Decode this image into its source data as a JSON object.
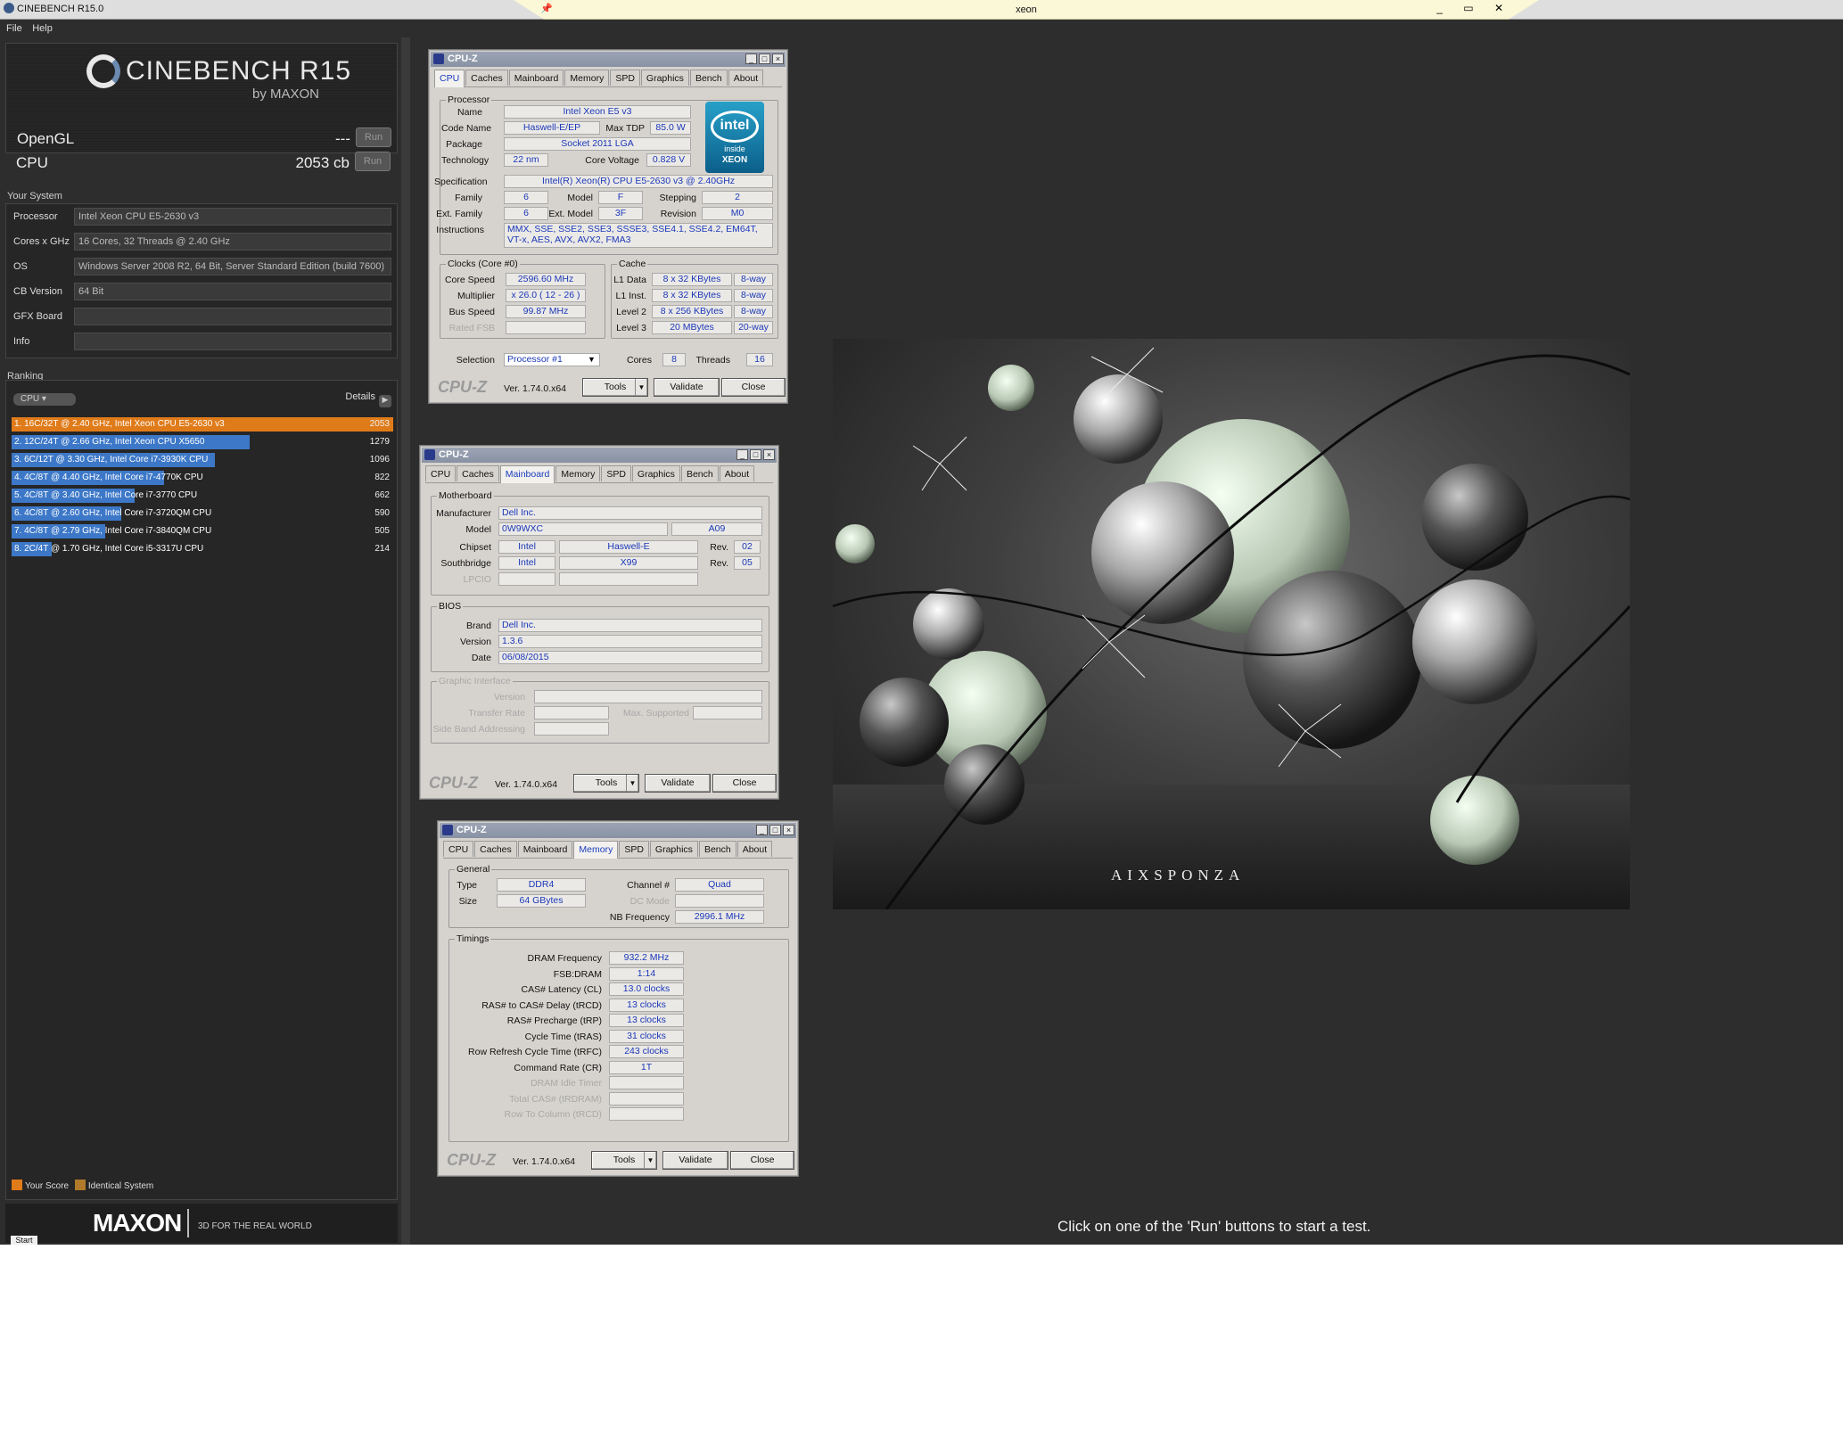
{
  "window": {
    "title": "CINEBENCH R15.0",
    "rdp_title": "xeon",
    "rdp_controls": "_ ▭ ✕"
  },
  "menu": [
    "File",
    "Help"
  ],
  "cinebench": {
    "logo_name": "CINEBENCH R15",
    "logo_by": "by MAXON",
    "opengl": {
      "label": "OpenGL",
      "value": "---",
      "button": "Run"
    },
    "cpu": {
      "label": "CPU",
      "value": "2053 cb",
      "button": "Run"
    },
    "your_system_heading": "Your System",
    "system": [
      {
        "key": "Processor",
        "value": "Intel Xeon CPU E5-2630 v3"
      },
      {
        "key": "Cores x GHz",
        "value": "16 Cores, 32 Threads @ 2.40 GHz"
      },
      {
        "key": "OS",
        "value": "Windows Server 2008 R2, 64 Bit, Server Standard Edition (build 7600)"
      },
      {
        "key": "CB Version",
        "value": "64 Bit"
      },
      {
        "key": "GFX Board",
        "value": ""
      },
      {
        "key": "Info",
        "value": ""
      }
    ],
    "ranking_heading": "Ranking",
    "ranking_filter": "CPU",
    "details_label": "Details",
    "ranking": [
      {
        "text": "1. 16C/32T @ 2.40 GHz, Intel Xeon CPU E5-2630 v3",
        "score": "2053",
        "kind": "your"
      },
      {
        "text": "2. 12C/24T @ 2.66 GHz, Intel Xeon CPU X5650",
        "score": "1279",
        "kind": "ref"
      },
      {
        "text": "3. 6C/12T @ 3.30 GHz,  Intel Core i7-3930K CPU",
        "score": "1096",
        "kind": "ref"
      },
      {
        "text": "4. 4C/8T @ 4.40 GHz, Intel Core i7-4770K CPU",
        "score": "822",
        "kind": "ref"
      },
      {
        "text": "5. 4C/8T @ 3.40 GHz,  Intel Core i7-3770 CPU",
        "score": "662",
        "kind": "ref"
      },
      {
        "text": "6. 4C/8T @ 2.60 GHz, Intel Core i7-3720QM CPU",
        "score": "590",
        "kind": "ref"
      },
      {
        "text": "7. 4C/8T @ 2.79 GHz,  Intel Core i7-3840QM CPU",
        "score": "505",
        "kind": "ref"
      },
      {
        "text": "8. 2C/4T @ 1.70 GHz,  Intel Core i5-3317U CPU",
        "score": "214",
        "kind": "ref"
      }
    ],
    "legend": {
      "your_score": "Your Score",
      "identical": "Identical System"
    },
    "maxon": "MAXON",
    "tagline": "3D FOR THE REAL WORLD",
    "start": "Start",
    "status": "Click on one of the 'Run' buttons to start a test.",
    "render_brand": "AIXSPONZA",
    "colors": {
      "your_score": "#e07b1a",
      "identical": "#b07a2a",
      "reference": "#3d78c8"
    }
  },
  "cpuz_common": {
    "title": "CPU-Z",
    "tabs": [
      "CPU",
      "Caches",
      "Mainboard",
      "Memory",
      "SPD",
      "Graphics",
      "Bench",
      "About"
    ],
    "logo": "CPU-Z",
    "version": "Ver. 1.74.0.x64",
    "tools": "Tools",
    "validate": "Validate",
    "close": "Close"
  },
  "cpuz_cpu": {
    "active_tab": "CPU",
    "processor_group": "Processor",
    "name_label": "Name",
    "name": "Intel Xeon E5 v3",
    "codename_label": "Code Name",
    "codename": "Haswell-E/EP",
    "maxtdp_label": "Max TDP",
    "maxtdp": "85.0 W",
    "package_label": "Package",
    "package": "Socket 2011 LGA",
    "technology_label": "Technology",
    "technology": "22 nm",
    "corevoltage_label": "Core Voltage",
    "corevoltage": "0.828 V",
    "spec_label": "Specification",
    "spec": "Intel(R) Xeon(R) CPU E5-2630 v3 @ 2.40GHz",
    "family_label": "Family",
    "family": "6",
    "model_label": "Model",
    "model": "F",
    "stepping_label": "Stepping",
    "stepping": "2",
    "extfamily_label": "Ext. Family",
    "extfamily": "6",
    "extmodel_label": "Ext. Model",
    "extmodel": "3F",
    "revision_label": "Revision",
    "revision": "M0",
    "instructions_label": "Instructions",
    "instructions": "MMX, SSE, SSE2, SSE3, SSSE3, SSE4.1, SSE4.2, EM64T, VT-x, AES, AVX, AVX2, FMA3",
    "clocks_group": "Clocks (Core #0)",
    "corespeed_label": "Core Speed",
    "corespeed": "2596.60 MHz",
    "multiplier_label": "Multiplier",
    "multiplier": "x 26.0 ( 12 - 26 )",
    "busspeed_label": "Bus Speed",
    "busspeed": "99.87 MHz",
    "ratedfsb_label": "Rated FSB",
    "cache_group": "Cache",
    "l1d_label": "L1 Data",
    "l1d": "8 x 32 KBytes",
    "l1d_way": "8-way",
    "l1i_label": "L1 Inst.",
    "l1i": "8 x 32 KBytes",
    "l1i_way": "8-way",
    "l2_label": "Level 2",
    "l2": "8 x 256 KBytes",
    "l2_way": "8-way",
    "l3_label": "Level 3",
    "l3": "20 MBytes",
    "l3_way": "20-way",
    "selection_label": "Selection",
    "selection": "Processor #1",
    "cores_label": "Cores",
    "cores": "8",
    "threads_label": "Threads",
    "threads": "16",
    "intel_badge": {
      "brand": "intel",
      "line1": "inside",
      "line2": "XEON"
    }
  },
  "cpuz_mainboard": {
    "active_tab": "Mainboard",
    "motherboard_group": "Motherboard",
    "manufacturer_label": "Manufacturer",
    "manufacturer": "Dell Inc.",
    "model_label": "Model",
    "model": "0W9WXC",
    "model_rev": "A09",
    "chipset_label": "Chipset",
    "chipset_vendor": "Intel",
    "chipset": "Haswell-E",
    "chipset_rev_label": "Rev.",
    "chipset_rev": "02",
    "southbridge_label": "Southbridge",
    "sb_vendor": "Intel",
    "sb": "X99",
    "sb_rev_label": "Rev.",
    "sb_rev": "05",
    "lpcio_label": "LPCIO",
    "bios_group": "BIOS",
    "brand_label": "Brand",
    "brand": "Dell Inc.",
    "version_label": "Version",
    "version": "1.3.6",
    "date_label": "Date",
    "date": "06/08/2015",
    "graphic_group": "Graphic Interface",
    "gi_version_label": "Version",
    "gi_transfer_label": "Transfer Rate",
    "gi_max_label": "Max. Supported",
    "gi_sideband_label": "Side Band Addressing"
  },
  "cpuz_memory": {
    "active_tab": "Memory",
    "general_group": "General",
    "type_label": "Type",
    "type": "DDR4",
    "size_label": "Size",
    "size": "64 GBytes",
    "channel_label": "Channel #",
    "channel": "Quad",
    "dcmode_label": "DC Mode",
    "nbfreq_label": "NB Frequency",
    "nbfreq": "2996.1 MHz",
    "timings_group": "Timings",
    "timings": [
      {
        "label": "DRAM Frequency",
        "value": "932.2 MHz",
        "enabled": true
      },
      {
        "label": "FSB:DRAM",
        "value": "1:14",
        "enabled": true
      },
      {
        "label": "CAS# Latency (CL)",
        "value": "13.0 clocks",
        "enabled": true
      },
      {
        "label": "RAS# to CAS# Delay (tRCD)",
        "value": "13 clocks",
        "enabled": true
      },
      {
        "label": "RAS# Precharge (tRP)",
        "value": "13 clocks",
        "enabled": true
      },
      {
        "label": "Cycle Time (tRAS)",
        "value": "31 clocks",
        "enabled": true
      },
      {
        "label": "Row Refresh Cycle Time (tRFC)",
        "value": "243 clocks",
        "enabled": true
      },
      {
        "label": "Command Rate (CR)",
        "value": "1T",
        "enabled": true
      },
      {
        "label": "DRAM Idle Timer",
        "value": "",
        "enabled": false
      },
      {
        "label": "Total CAS# (tRDRAM)",
        "value": "",
        "enabled": false
      },
      {
        "label": "Row To Column (tRCD)",
        "value": "",
        "enabled": false
      }
    ]
  }
}
